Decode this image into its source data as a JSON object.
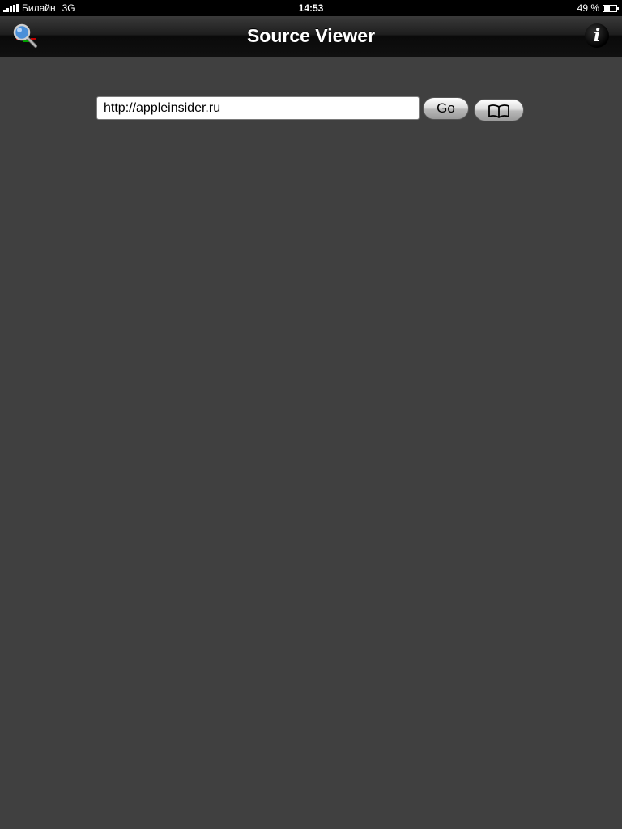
{
  "status_bar": {
    "carrier": "Билайн",
    "network": "3G",
    "time": "14:53",
    "battery_percent": "49 %",
    "battery_level": 0.49
  },
  "nav_bar": {
    "title": "Source Viewer",
    "left_icon": "magnifier-icon",
    "right_icon": "info-icon",
    "info_label": "i"
  },
  "url_bar": {
    "value": "http://appleinsider.ru",
    "go_label": "Go",
    "bookmarks_icon": "open-book-icon"
  },
  "colors": {
    "background": "#404040",
    "nav_bar": "#1e1e1e",
    "status_bar": "#000000"
  }
}
